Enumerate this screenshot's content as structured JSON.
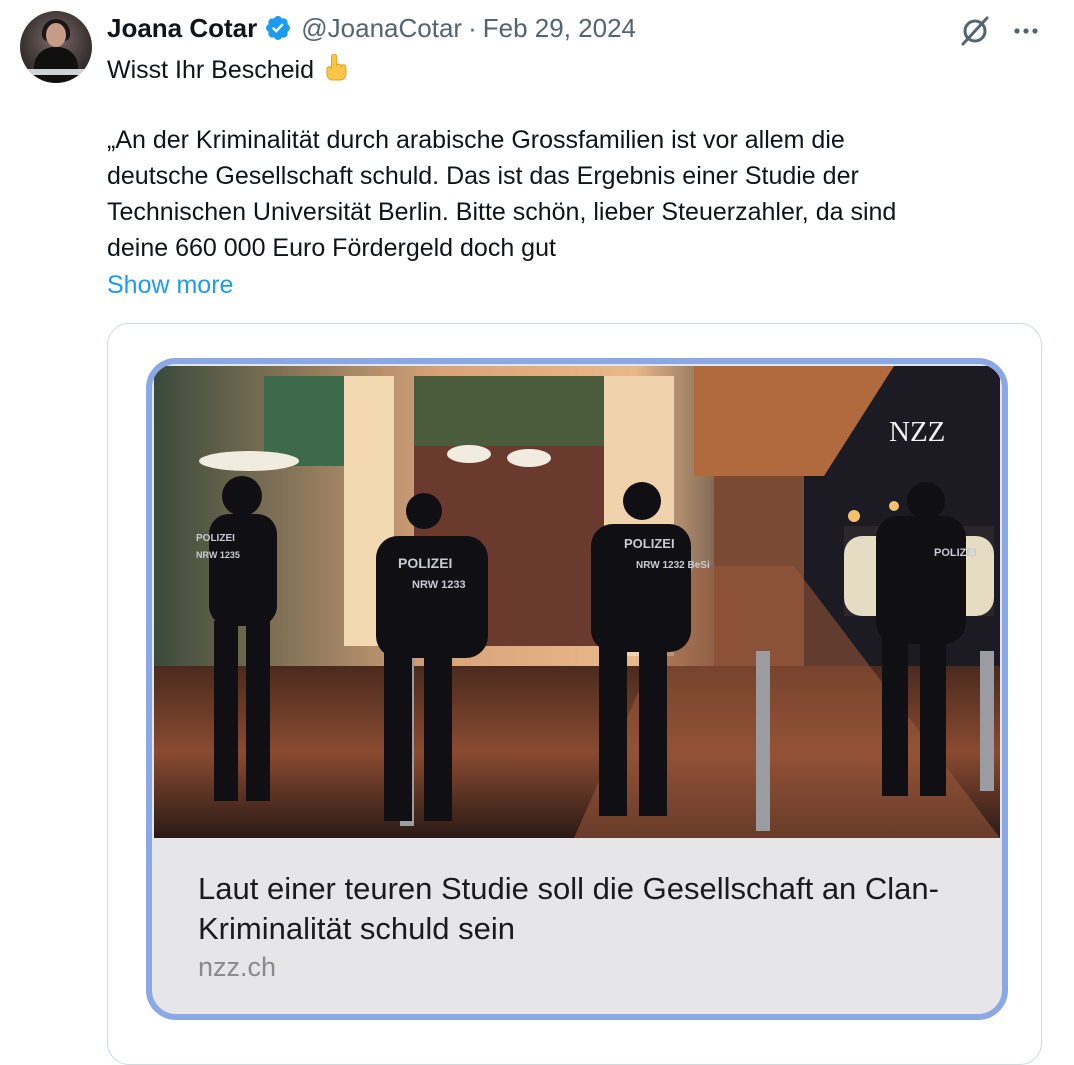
{
  "author": {
    "name": "Joana Cotar",
    "handle": "@JoanaCotar",
    "separator": "·",
    "date": "Feb 29, 2024"
  },
  "icons": {
    "verified": "verified-badge-icon",
    "grok": "grok-icon",
    "more": "more-options-icon",
    "emoji": "pointing-up-hand-emoji"
  },
  "tweet": {
    "lines": [
      "Wisst Ihr Bescheid",
      "„An der Kriminalität durch arabische Grossfamilien ist vor allem die",
      "deutsche Gesellschaft schuld. Das ist das Ergebnis einer Studie der",
      "Technischen Universität Berlin. Bitte schön, lieber Steuerzahler, da sind",
      "deine 660 000 Euro Fördergeld doch gut"
    ],
    "show_more": "Show more"
  },
  "card": {
    "watermark": "NZZ",
    "headline": "Laut einer teuren Studie soll die Gesellschaft an Clan-Kriminalität schuld sein",
    "domain": "nzz.ch",
    "uniform_texts": {
      "officer1": "POLIZEI",
      "officer1_sub": "NRW 1235",
      "officer2": "POLIZEI",
      "officer2_sub": "NRW 1233",
      "officer3": "POLIZEI",
      "officer3_sub": "NRW 1232 BeSi",
      "officer4": "POLIZEI"
    }
  },
  "colors": {
    "link": "#1d9bf0",
    "secondary_text": "#536471",
    "verified": "#1d9bf0",
    "card_highlight": "#8aa7e6"
  }
}
